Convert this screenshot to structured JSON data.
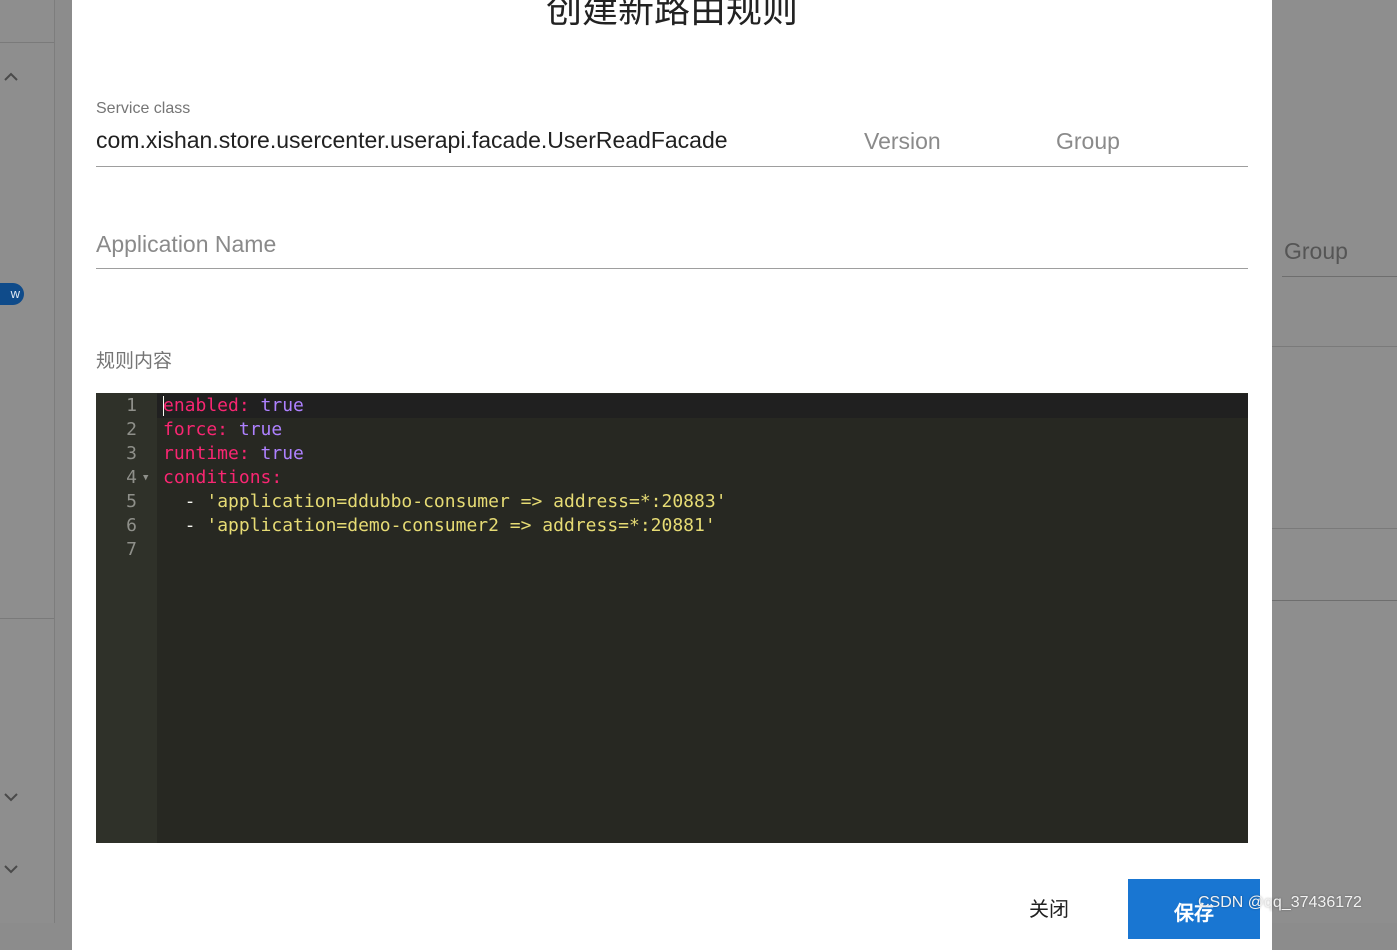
{
  "background": {
    "right_group_label": "Group",
    "pill_text": "w"
  },
  "dialog": {
    "title": "创建新路由规则",
    "service_class_label": "Service class",
    "service_class_value": "com.xishan.store.usercenter.userapi.facade.UserReadFacade",
    "version_placeholder": "Version",
    "group_placeholder": "Group",
    "application_name_placeholder": "Application Name",
    "rule_content_label": "规则内容",
    "editor": {
      "line_numbers": [
        "1",
        "2",
        "3",
        "4",
        "5",
        "6",
        "7"
      ],
      "lines": [
        [
          {
            "t": "enabled:",
            "c": "k"
          },
          {
            "t": " ",
            "c": ""
          },
          {
            "t": "true",
            "c": "b"
          }
        ],
        [
          {
            "t": "force:",
            "c": "k"
          },
          {
            "t": " ",
            "c": ""
          },
          {
            "t": "true",
            "c": "b"
          }
        ],
        [
          {
            "t": "runtime:",
            "c": "k"
          },
          {
            "t": " ",
            "c": ""
          },
          {
            "t": "true",
            "c": "b"
          }
        ],
        [
          {
            "t": "conditions:",
            "c": "k"
          }
        ],
        [
          {
            "t": "  - ",
            "c": ""
          },
          {
            "t": "'application=ddubbo-consumer => address=*:20883'",
            "c": "s"
          }
        ],
        [
          {
            "t": "  - ",
            "c": ""
          },
          {
            "t": "'application=demo-consumer2 => address=*:20881'",
            "c": "s"
          }
        ],
        []
      ],
      "colors": {
        "key": "#f92672",
        "boolean": "#ae81ff",
        "string": "#e6db74",
        "background": "#272822"
      }
    },
    "buttons": {
      "close_label": "关闭",
      "save_label": "保存"
    }
  },
  "watermark": "CSDN @qq_37436172"
}
